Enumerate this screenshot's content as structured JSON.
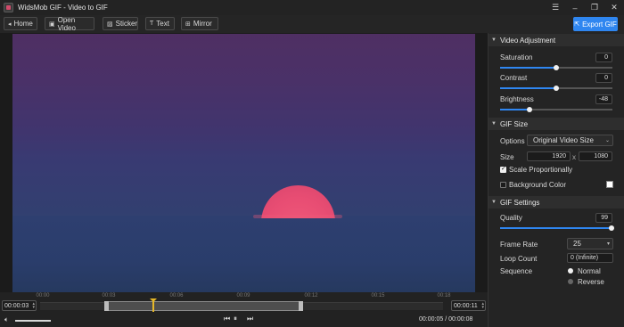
{
  "window": {
    "title": "WidsMob GIF - Video to GIF"
  },
  "toolbar": {
    "home": "Home",
    "open_video": "Open Video",
    "sticker": "Sticker",
    "text": "Text",
    "mirror": "Mirror",
    "export": "Export GIF"
  },
  "timeline": {
    "ticks": [
      "00:00",
      "00:03",
      "00:06",
      "00:09",
      "00:12",
      "00:15",
      "00:18"
    ],
    "start_time": "00:00:03",
    "end_time": "00:00:11",
    "current_time": "00:00:05",
    "separator": "/",
    "total_time": "00:00:08"
  },
  "video_adjustment": {
    "header": "Video Adjustment",
    "saturation": {
      "label": "Saturation",
      "value": "0",
      "level": 0.5
    },
    "contrast": {
      "label": "Contrast",
      "value": "0",
      "level": 0.5
    },
    "brightness": {
      "label": "Brightness",
      "value": "-48",
      "level": 0.26
    }
  },
  "gif_size": {
    "header": "GIF Size",
    "options_label": "Options",
    "options_value": "Original Video Size",
    "size_label": "Size",
    "width": "1920",
    "times": "x",
    "height": "1080",
    "scale_label": "Scale Proportionally",
    "scale_checked": true,
    "bg_label": "Background Color",
    "bg_checked": false,
    "bg_color": "#ffffff"
  },
  "gif_settings": {
    "header": "GIF Settings",
    "quality": {
      "label": "Quality",
      "value": "99",
      "level": 0.99
    },
    "frame_rate_label": "Frame Rate",
    "frame_rate_value": "25",
    "loop_label": "Loop Count",
    "loop_value": "0 (Infinite)",
    "sequence_label": "Sequence",
    "sequence_normal": "Normal",
    "sequence_reverse": "Reverse",
    "sequence_selected": "Normal"
  },
  "colors": {
    "accent": "#2f86f0",
    "playhead": "#e6b828"
  }
}
